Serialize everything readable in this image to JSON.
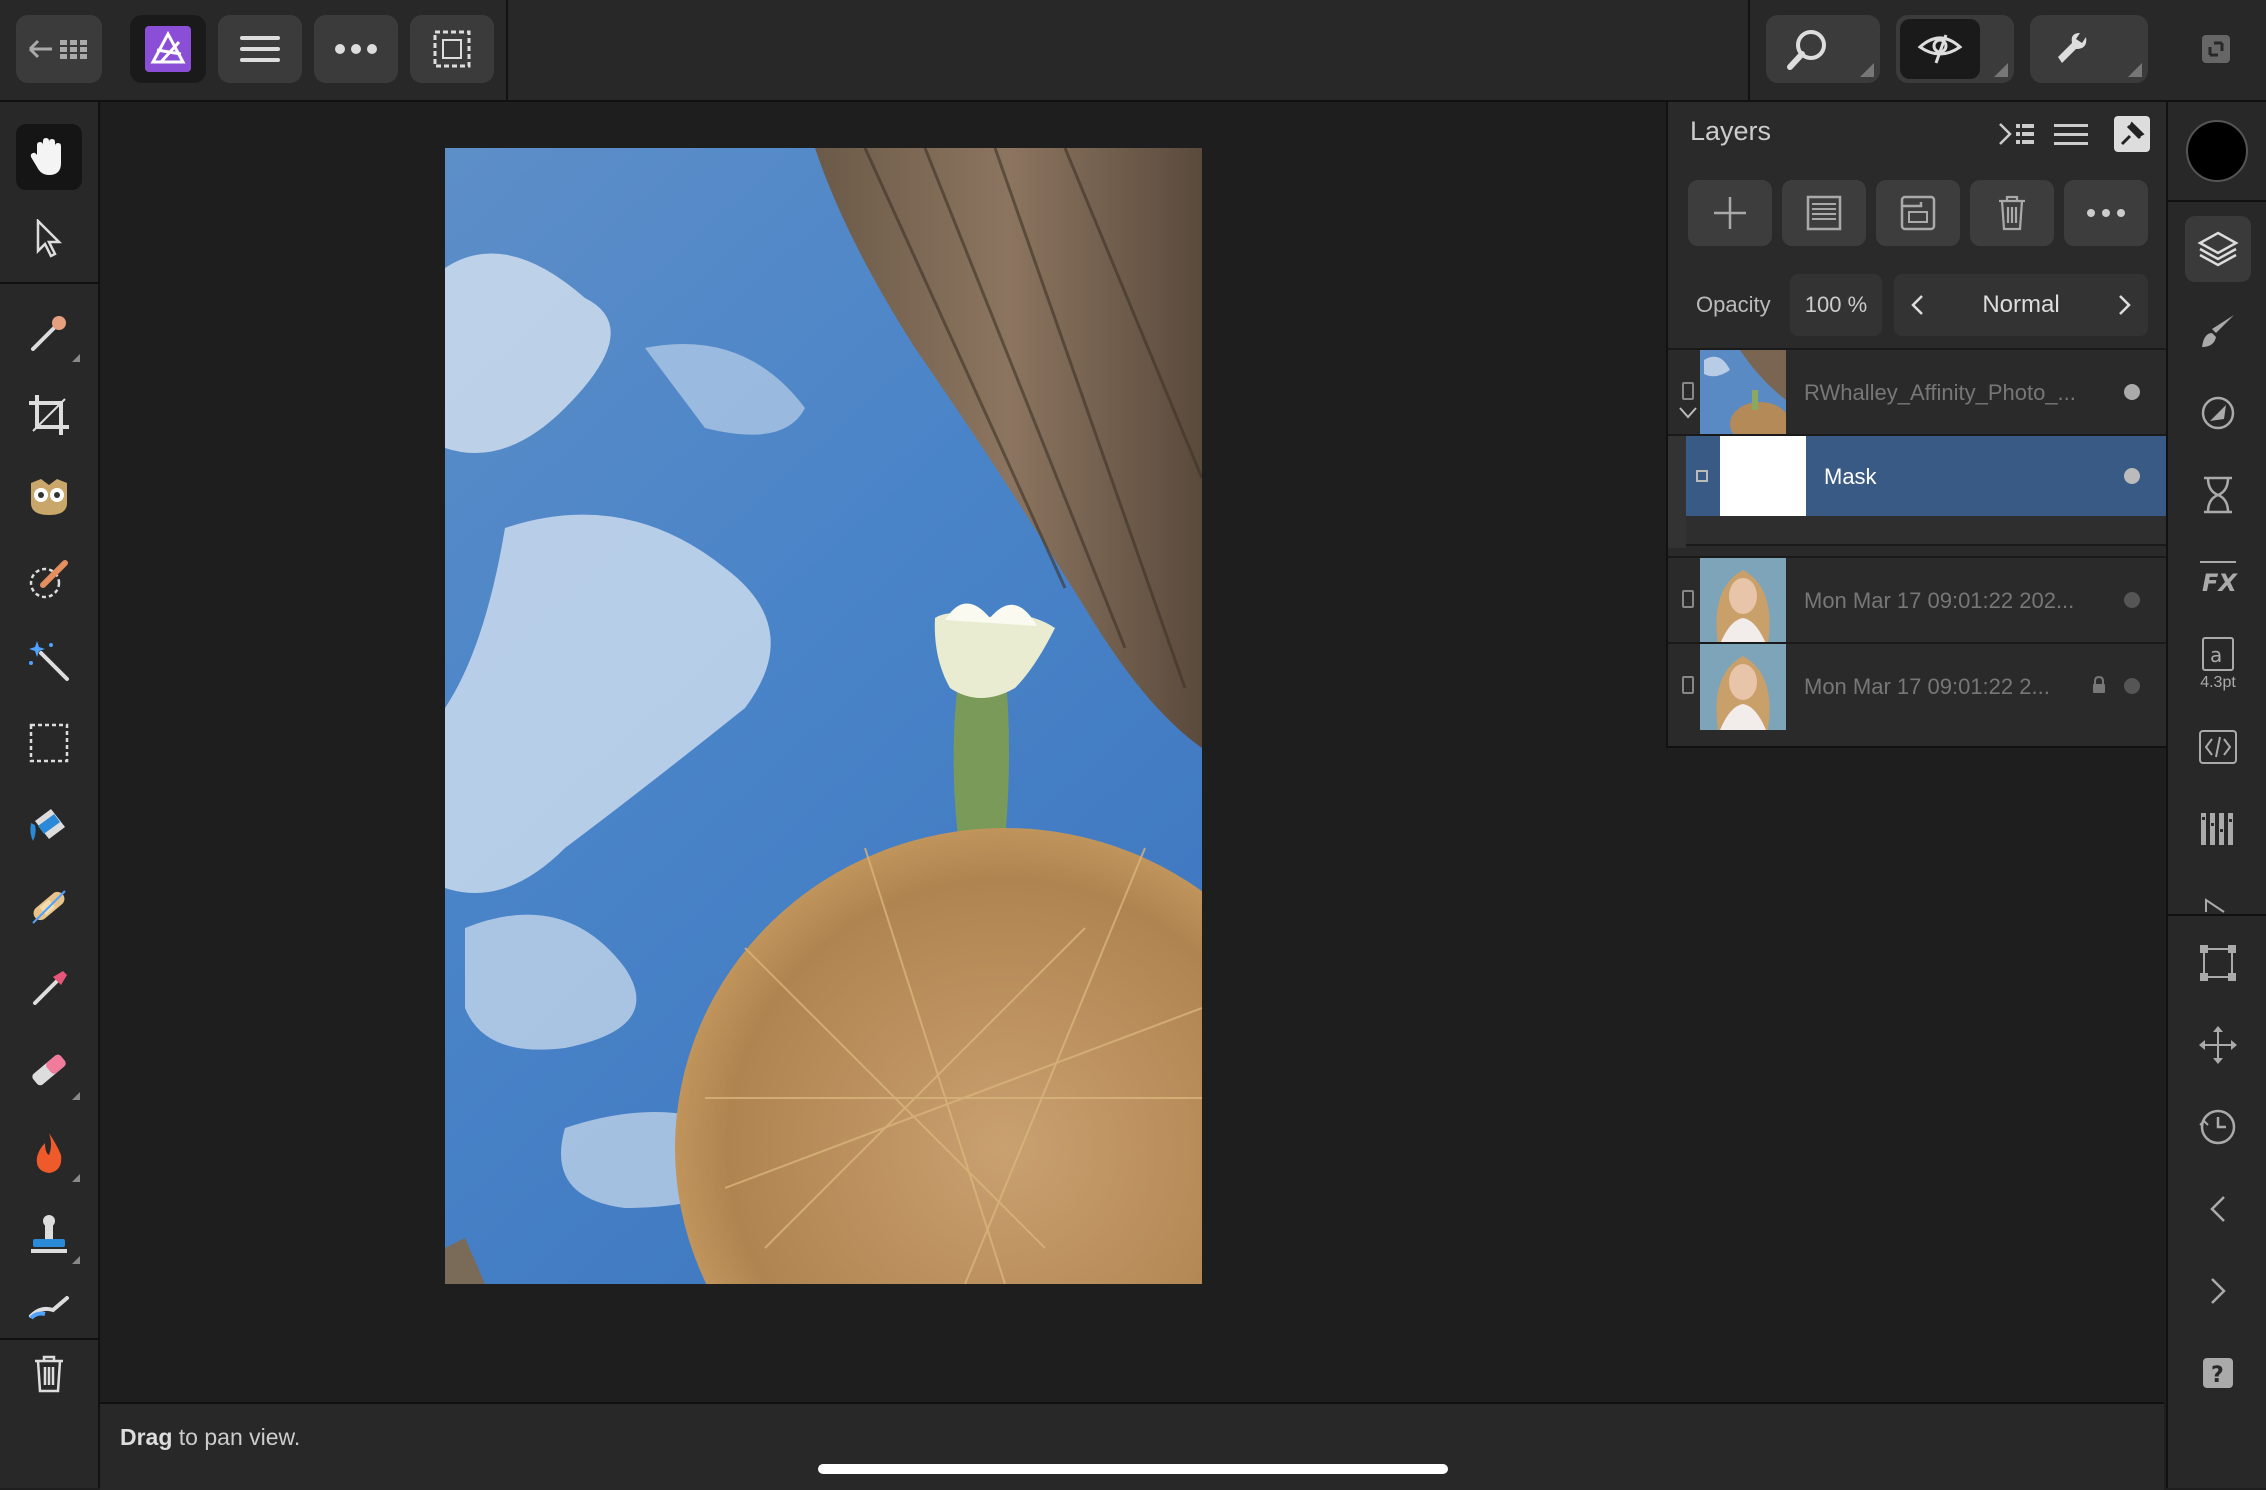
{
  "panel": {
    "title": "Layers",
    "opacity_label": "Opacity",
    "opacity_value": "100 %",
    "blend_mode": "Normal"
  },
  "layers": [
    {
      "name": "RWhalley_Affinity_Photo_...",
      "expanded": true
    },
    {
      "name": "Mask",
      "selected": true
    },
    {
      "name": "Mon Mar 17 09:01:22 202..."
    },
    {
      "name": "Mon Mar 17 09:01:22 2...",
      "locked": true
    }
  ],
  "right_strip": {
    "text_size_label": "4.3pt"
  },
  "status": {
    "bold": "Drag",
    "rest": " to pan view."
  },
  "colors": {
    "primary_color": "#000000",
    "selected_layer": "#3a5a86",
    "app_icon": "#8a4fd6"
  },
  "icons": {
    "top": [
      "back-arrow-icon",
      "grid-icon",
      "affinity-photo-icon",
      "menu-icon",
      "more-icon",
      "selection-icon",
      "zoom-icon",
      "view-icon",
      "assistant-icon",
      "expand-icon"
    ],
    "tools": [
      "hand-icon",
      "move-icon",
      "color-picker-icon",
      "crop-icon",
      "red-eye-icon",
      "selection-brush-icon",
      "magic-wand-icon",
      "marquee-icon",
      "flood-fill-icon",
      "healing-icon",
      "paint-brush-icon",
      "erase-brush-icon",
      "burn-icon",
      "clone-icon",
      "smudge-icon",
      "trash-icon"
    ],
    "studio": [
      "layers-icon",
      "brushes-icon",
      "adjustments-icon",
      "history-icon",
      "effects-icon",
      "text-styles-icon",
      "source-icon",
      "channels-icon",
      "transform-icon",
      "navigator-icon",
      "time-icon",
      "previous-icon",
      "next-icon",
      "help-icon"
    ]
  }
}
